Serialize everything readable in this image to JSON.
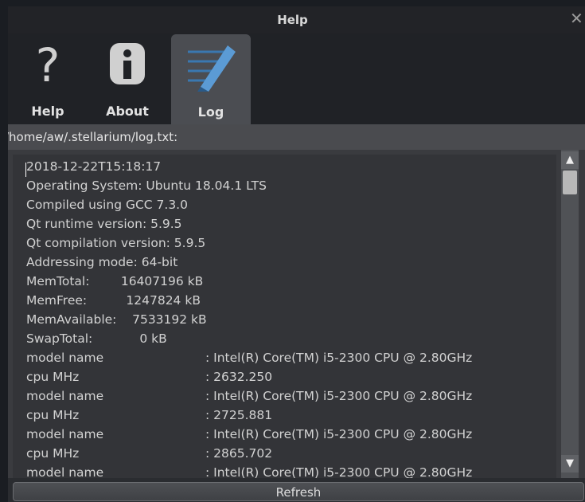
{
  "window": {
    "title": "Help",
    "close_glyph": "✕"
  },
  "tabs": [
    {
      "label": "Help",
      "icon": "question-mark-icon"
    },
    {
      "label": "About",
      "icon": "info-icon"
    },
    {
      "label": "Log",
      "icon": "pen-notepad-icon",
      "active": true
    }
  ],
  "log": {
    "path": "/home/aw/.stellarium/log.txt:",
    "lines": [
      "2018-12-22T15:18:17",
      "Operating System: Ubuntu 18.04.1 LTS",
      "Compiled using GCC 7.3.0",
      "Qt runtime version: 5.9.5",
      "Qt compilation version: 5.9.5",
      "Addressing mode: 64-bit",
      "MemTotal:        16407196 kB",
      "MemFree:          1247824 kB",
      "MemAvailable:    7533192 kB",
      "SwapTotal:            0 kB"
    ],
    "cpu_lines": [
      {
        "key": "model name",
        "value": ": Intel(R) Core(TM) i5-2300 CPU @ 2.80GHz"
      },
      {
        "key": "cpu MHz",
        "value": ": 2632.250"
      },
      {
        "key": "model name",
        "value": ": Intel(R) Core(TM) i5-2300 CPU @ 2.80GHz"
      },
      {
        "key": "cpu MHz",
        "value": ": 2725.881"
      },
      {
        "key": "model name",
        "value": ": Intel(R) Core(TM) i5-2300 CPU @ 2.80GHz"
      },
      {
        "key": "cpu MHz",
        "value": ": 2865.702"
      },
      {
        "key": "model name",
        "value": ": Intel(R) Core(TM) i5-2300 CPU @ 2.80GHz"
      }
    ]
  },
  "scrollbar": {
    "up": "▲",
    "down": "▼"
  },
  "refresh_label": "Refresh",
  "colors": {
    "active_tab": "#4b4d52",
    "background": "#2a2c30",
    "text": "#d2d2d2"
  }
}
